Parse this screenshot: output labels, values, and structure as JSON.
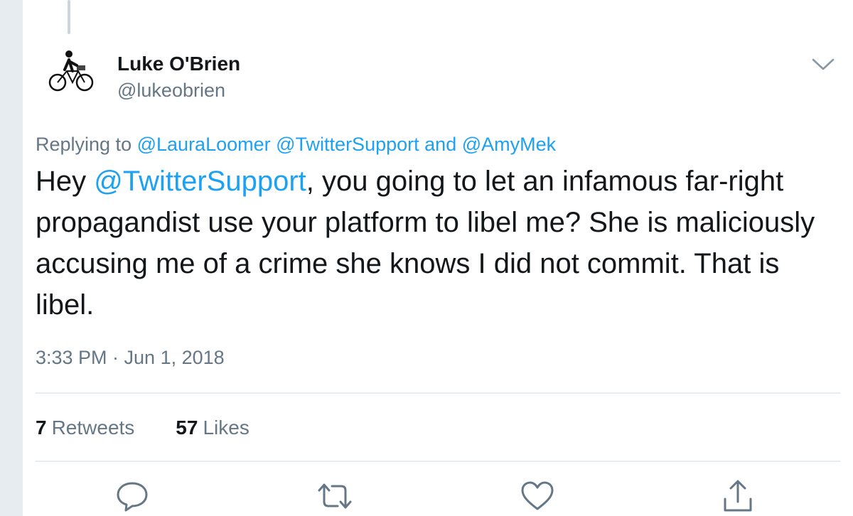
{
  "tweet": {
    "author": {
      "name": "Luke O'Brien",
      "handle": "@lukeobrien"
    },
    "reply_to": {
      "prefix": "Replying to",
      "mention_1": "@LauraLoomer",
      "mention_2": "@TwitterSupport",
      "conjunction": "and",
      "mention_3": "@AmyMek"
    },
    "text": {
      "lead": "Hey ",
      "mention": "@TwitterSupport",
      "body": ", you going to let an infamous far-right propagandist use your platform to libel me? She is maliciously accusing me of a crime she knows I did not commit. That is libel."
    },
    "timestamp": "3:33 PM · Jun 1, 2018",
    "stats": {
      "retweets_count": "7",
      "retweets_label": "Retweets",
      "likes_count": "57",
      "likes_label": "Likes"
    },
    "icons": {
      "avatar": "cyclist-avatar",
      "menu": "chevron-down-icon",
      "reply": "reply-icon",
      "retweet": "retweet-icon",
      "like": "heart-icon",
      "share": "share-icon"
    },
    "colors": {
      "link": "#1da1f2",
      "secondary_text": "#657786",
      "icon": "#657786",
      "divider": "#e6ecf0"
    }
  }
}
